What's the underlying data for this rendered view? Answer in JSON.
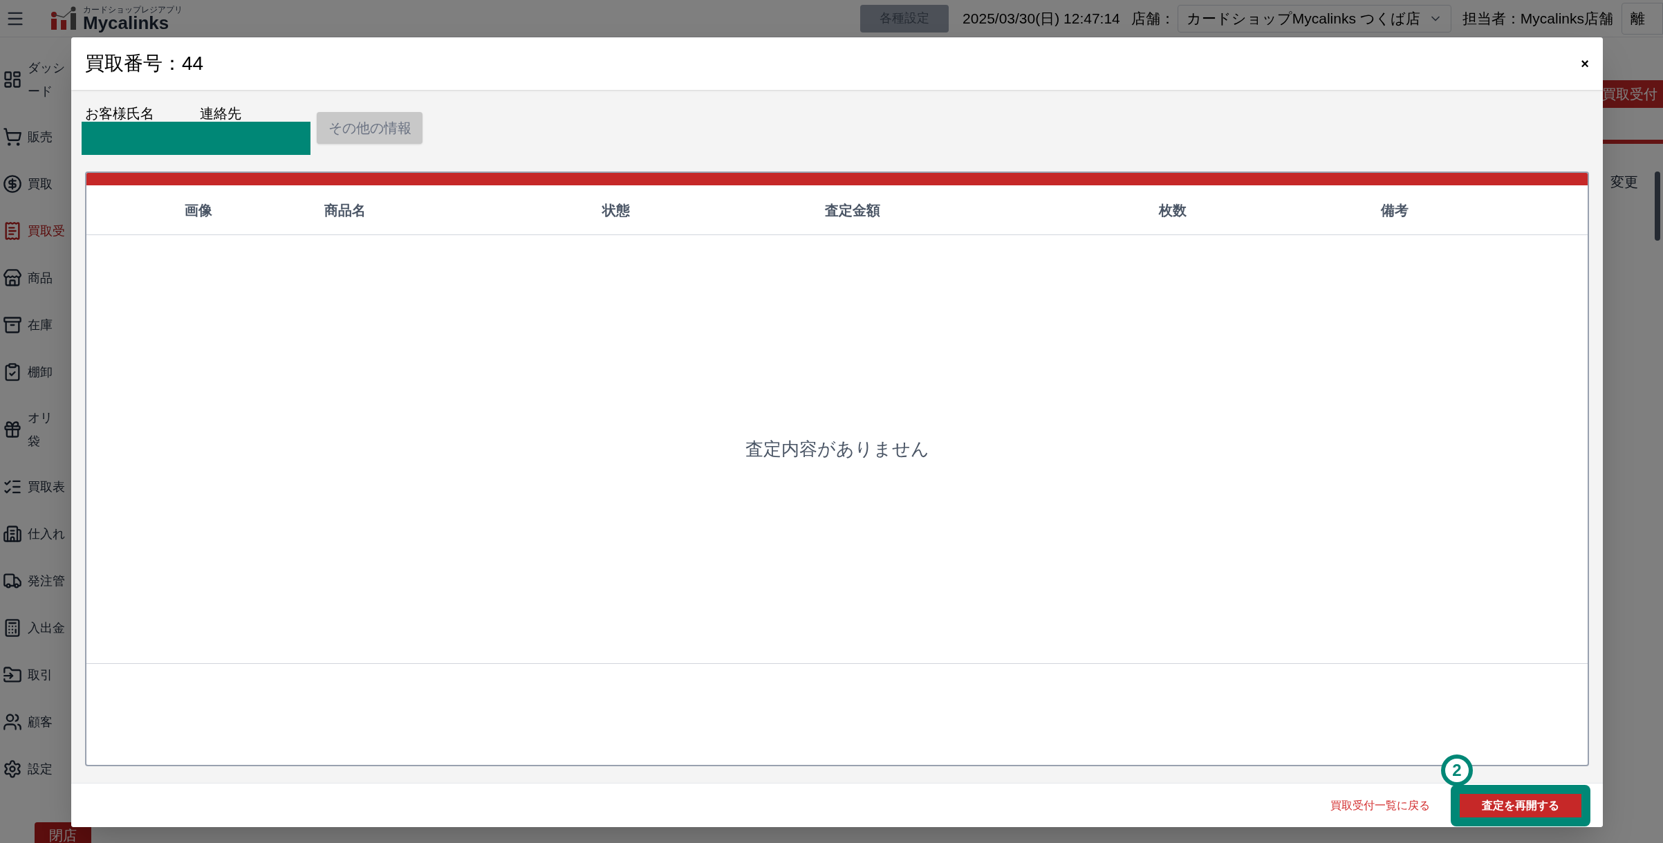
{
  "header": {
    "logo": {
      "tagline": "カードショップレジアプリ",
      "name": "Mycalinks"
    },
    "settings_button": "各種設定",
    "datetime": "2025/03/30(日) 12:47:14",
    "store_label": "店舗：",
    "store_select": "カードショップMycalinks つくば店",
    "staff": "担当者：Mycalinks店舗",
    "away_button": "離"
  },
  "sidebar": {
    "items": [
      {
        "lines": [
          "ダッシ",
          "ード"
        ],
        "selected": false
      },
      {
        "lines": [
          "販売"
        ],
        "selected": false
      },
      {
        "lines": [
          "買取"
        ],
        "selected": false
      },
      {
        "lines": [
          "買取受"
        ],
        "selected": true
      },
      {
        "lines": [
          "商品"
        ],
        "selected": false
      },
      {
        "lines": [
          "在庫"
        ],
        "selected": false
      },
      {
        "lines": [
          "棚卸"
        ],
        "selected": false
      },
      {
        "lines": [
          "オリ",
          "袋"
        ],
        "selected": false
      },
      {
        "lines": [
          "買取表"
        ],
        "selected": false
      },
      {
        "lines": [
          "仕入れ"
        ],
        "selected": false
      },
      {
        "lines": [
          "発注管"
        ],
        "selected": false
      },
      {
        "lines": [
          "入出金"
        ],
        "selected": false
      },
      {
        "lines": [
          "取引"
        ],
        "selected": false
      },
      {
        "lines": [
          "顧客"
        ],
        "selected": false
      },
      {
        "lines": [
          "設定"
        ],
        "selected": false
      }
    ],
    "close_button": "閉店"
  },
  "background_page": {
    "reception_button": "買取受付",
    "change_text": "変更"
  },
  "modal": {
    "title": "買取番号：44",
    "close": "×",
    "customer": {
      "name_label": "お客様氏名",
      "contact_label": "連絡先",
      "other_info_button": "その他の情報"
    },
    "table": {
      "columns": [
        "画像",
        "商品名",
        "状態",
        "査定金額",
        "枚数",
        "備考"
      ],
      "empty_message": "査定内容がありません"
    },
    "footer": {
      "back_link": "買取受付一覧に戻る",
      "resume_button": "査定を再開する",
      "step_marker": "2"
    }
  }
}
